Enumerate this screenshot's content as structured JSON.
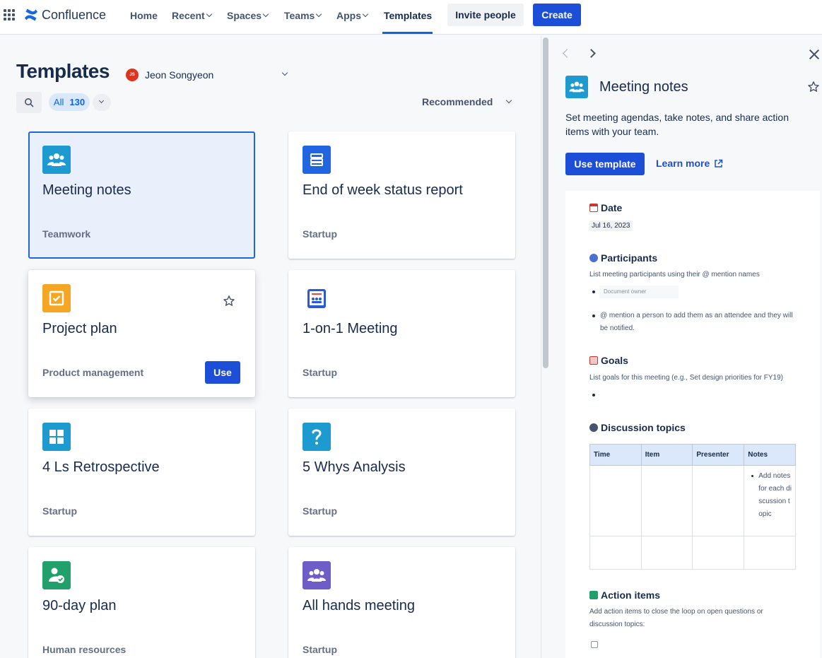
{
  "nav": {
    "brand": "Confluence",
    "items": [
      {
        "label": "Home",
        "has_menu": false
      },
      {
        "label": "Recent",
        "has_menu": true
      },
      {
        "label": "Spaces",
        "has_menu": true
      },
      {
        "label": "Teams",
        "has_menu": true
      },
      {
        "label": "Apps",
        "has_menu": true
      },
      {
        "label": "Templates",
        "has_menu": false,
        "active": true
      }
    ],
    "invite_label": "Invite people",
    "create_label": "Create"
  },
  "main": {
    "title": "Templates",
    "user": {
      "initials": "JS",
      "name": "Jeon Songyeon"
    },
    "filter": {
      "label": "All",
      "count": "130"
    },
    "sort_label": "Recommended",
    "cards": [
      {
        "title": "Meeting notes",
        "category": "Teamwork",
        "icon": "people-icon",
        "color": "#1d9bd1",
        "state": "selected"
      },
      {
        "title": "End of week status report",
        "category": "Startup",
        "icon": "stack-icon",
        "color": "#2166e0"
      },
      {
        "title": "Project plan",
        "category": "Product management",
        "icon": "checkbox-icon",
        "color": "#f5a623",
        "state": "hover",
        "use_label": "Use"
      },
      {
        "title": "1-on-1 Meeting",
        "category": "Startup",
        "icon": "whiteboard-icon",
        "color": "#2b5bd4"
      },
      {
        "title": "4 Ls Retrospective",
        "category": "Startup",
        "icon": "grid-four-icon",
        "color": "#1d9bd1"
      },
      {
        "title": "5 Whys Analysis",
        "category": "Startup",
        "icon": "question-icon",
        "color": "#1d9bd1"
      },
      {
        "title": "90-day plan",
        "category": "Human resources",
        "icon": "person-check-icon",
        "color": "#22a06b"
      },
      {
        "title": "All hands meeting",
        "category": "Startup",
        "icon": "people-icon",
        "color": "#6e5dc6"
      }
    ]
  },
  "panel": {
    "title": "Meeting notes",
    "description": "Set meeting agendas, take notes, and share action items with your team.",
    "use_label": "Use template",
    "learn_label": "Learn more",
    "preview": {
      "date_heading": "Date",
      "date_value": "Jul 16, 2023",
      "participants_heading": "Participants",
      "participants_text": "List meeting participants using their @ mention names",
      "owner_placeholder": "Document owner",
      "mention_text": "@ mention a person to add them as an attendee and they will be notified.",
      "goals_heading": "Goals",
      "goals_text": "List goals for this meeting (e.g., Set design priorities for FY19)",
      "discussion_heading": "Discussion topics",
      "table_headers": [
        "Time",
        "Item",
        "Presenter",
        "Notes"
      ],
      "table_note": "Add notes for each discussion topic",
      "action_heading": "Action items",
      "action_text": "Add action items to close the loop on open questions or discussion topics:"
    }
  }
}
